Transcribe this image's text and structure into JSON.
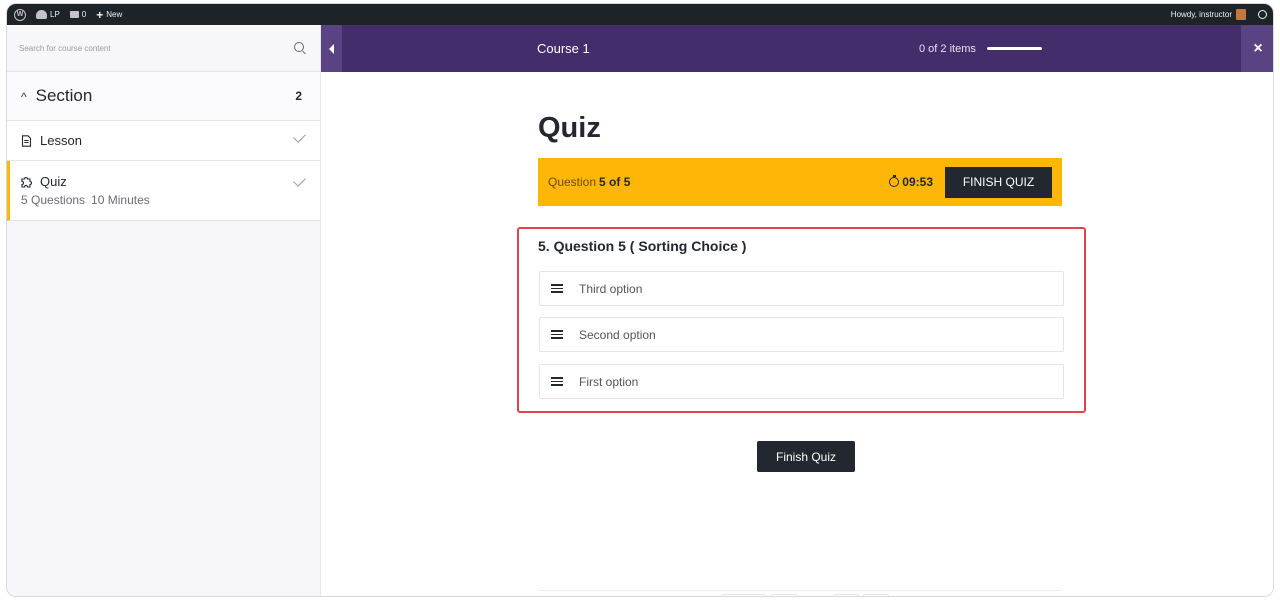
{
  "adminbar": {
    "site_label": "LP",
    "comments_count": "0",
    "new_label": "New",
    "greeting": "Howdy, instructor"
  },
  "sidebar": {
    "search_placeholder": "Search for course content",
    "section": {
      "title": "Section",
      "count": "2"
    },
    "items": [
      {
        "label": "Lesson",
        "type": "lesson",
        "completed": true
      },
      {
        "label": "Quiz",
        "type": "quiz",
        "completed": true,
        "questions": "5 Questions",
        "duration": "10 Minutes"
      }
    ]
  },
  "header": {
    "course_title": "Course 1",
    "progress_text": "0 of 2 items",
    "progress_fraction": 1.0,
    "close_label": "×"
  },
  "quiz": {
    "title": "Quiz",
    "question_label": "Question",
    "question_counter": "5 of 5",
    "timer": "09:53",
    "finish_top_label": "FINISH QUIZ",
    "question_title": "5. Question 5 ( Sorting Choice )",
    "options": [
      "Third option",
      "Second option",
      "First option"
    ],
    "finish_bottom_label": "Finish Quiz"
  },
  "colors": {
    "header_bg": "#442d6b",
    "status_bg": "#ffb606",
    "highlight_border": "#e0424a",
    "dark_button": "#23272f"
  }
}
